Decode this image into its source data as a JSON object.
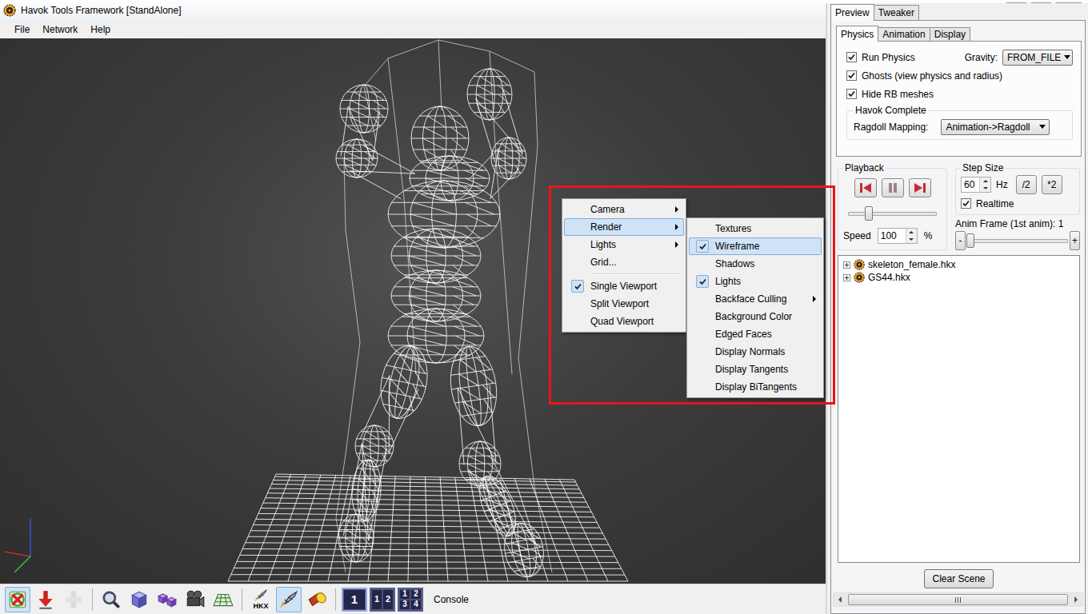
{
  "window": {
    "title": "Havok Tools Framework [StandAlone]"
  },
  "menu_bar": [
    {
      "label": "File"
    },
    {
      "label": "Network"
    },
    {
      "label": "Help"
    }
  ],
  "context_menu": {
    "sections": [
      {
        "items": [
          {
            "label": "Camera",
            "kind": "submenu",
            "checked": false,
            "highlighted": false
          },
          {
            "label": "Render",
            "kind": "submenu",
            "checked": false,
            "highlighted": true
          },
          {
            "label": "Lights",
            "kind": "submenu",
            "checked": false,
            "highlighted": false
          },
          {
            "label": "Grid...",
            "kind": "command",
            "checked": false,
            "highlighted": false
          }
        ]
      },
      {
        "items": [
          {
            "label": "Single Viewport",
            "kind": "command",
            "checked": true,
            "highlighted": false
          },
          {
            "label": "Split Viewport",
            "kind": "command",
            "checked": false,
            "highlighted": false
          },
          {
            "label": "Quad Viewport",
            "kind": "command",
            "checked": false,
            "highlighted": false
          }
        ]
      }
    ]
  },
  "render_menu": {
    "items": [
      {
        "label": "Textures",
        "kind": "command",
        "checked": false,
        "highlighted": false
      },
      {
        "label": "Wireframe",
        "kind": "command",
        "checked": true,
        "highlighted": true
      },
      {
        "label": "Shadows",
        "kind": "command",
        "checked": false,
        "highlighted": false
      },
      {
        "label": "Lights",
        "kind": "command",
        "checked": true,
        "highlighted": false
      },
      {
        "label": "Backface Culling",
        "kind": "submenu",
        "checked": false,
        "highlighted": false
      },
      {
        "label": "Background Color",
        "kind": "command",
        "checked": false,
        "highlighted": false
      },
      {
        "label": "Edged Faces",
        "kind": "command",
        "checked": false,
        "highlighted": false
      },
      {
        "label": "Display Normals",
        "kind": "command",
        "checked": false,
        "highlighted": false
      },
      {
        "label": "Display Tangents",
        "kind": "command",
        "checked": false,
        "highlighted": false
      },
      {
        "label": "Display BiTangents",
        "kind": "command",
        "checked": false,
        "highlighted": false
      }
    ]
  },
  "panel_tabs": [
    {
      "label": "Preview",
      "selected": true
    },
    {
      "label": "Tweaker",
      "selected": false
    }
  ],
  "sub_tabs": [
    {
      "label": "Physics",
      "selected": true
    },
    {
      "label": "Animation",
      "selected": false
    },
    {
      "label": "Display",
      "selected": false
    }
  ],
  "physics": {
    "checkboxes": [
      {
        "label": "Run Physics",
        "checked": true
      },
      {
        "label": "Ghosts (view physics and radius)",
        "checked": true
      },
      {
        "label": "Hide RB meshes",
        "checked": true
      }
    ],
    "gravity": {
      "label": "Gravity:",
      "value": "FROM_FILE"
    },
    "group": {
      "title": "Havok Complete",
      "label": "Ragdoll Mapping:",
      "value": "Animation->Ragdoll"
    }
  },
  "playback": {
    "title": "Playback",
    "buttons": [
      {
        "kind": "rewind"
      },
      {
        "kind": "pause"
      },
      {
        "kind": "play"
      }
    ],
    "level": 0.23,
    "speed_label": "Speed",
    "speed_value": "100",
    "speed_unit": "%"
  },
  "step_size": {
    "title": "Step Size",
    "value": "60",
    "unit": "Hz",
    "buttons": [
      "/2",
      "*2"
    ],
    "realtime": {
      "label": "Realtime",
      "checked": true
    }
  },
  "anim_frame": {
    "label": "Anim Frame (1st anim): 1",
    "minus": "-",
    "plus": "+",
    "level": 0.03
  },
  "tree": [
    {
      "label": "skeleton_female.hkx",
      "expanded": false
    },
    {
      "label": "GS44.hkx",
      "expanded": false
    }
  ],
  "clear_button": "Clear Scene",
  "toolbar": {
    "tool_groups": [
      {
        "tools": [
          {
            "kind": "physics-select",
            "active": true,
            "disabled": false
          },
          {
            "kind": "drop",
            "active": false,
            "disabled": false
          },
          {
            "kind": "grab",
            "active": false,
            "disabled": true
          }
        ]
      },
      {
        "tools": [
          {
            "kind": "zoom",
            "active": false,
            "disabled": false
          },
          {
            "kind": "box",
            "active": false,
            "disabled": false
          },
          {
            "kind": "boxes",
            "active": false,
            "disabled": false
          },
          {
            "kind": "camera",
            "active": false,
            "disabled": false
          },
          {
            "kind": "grid",
            "active": false,
            "disabled": false
          }
        ]
      },
      {
        "tools": [
          {
            "kind": "rocket-hkx",
            "label": "HKX",
            "active": false,
            "disabled": false
          },
          {
            "kind": "rocket",
            "active": true,
            "disabled": false
          },
          {
            "kind": "flashlight",
            "active": false,
            "disabled": false
          }
        ]
      }
    ],
    "viewport_buttons": [
      {
        "labels": [
          "1"
        ],
        "selected": true
      },
      {
        "labels": [
          "1",
          "2"
        ],
        "selected": false
      },
      {
        "labels": [
          "1",
          "2",
          "3",
          "4"
        ],
        "selected": false
      }
    ],
    "console": "Console"
  }
}
